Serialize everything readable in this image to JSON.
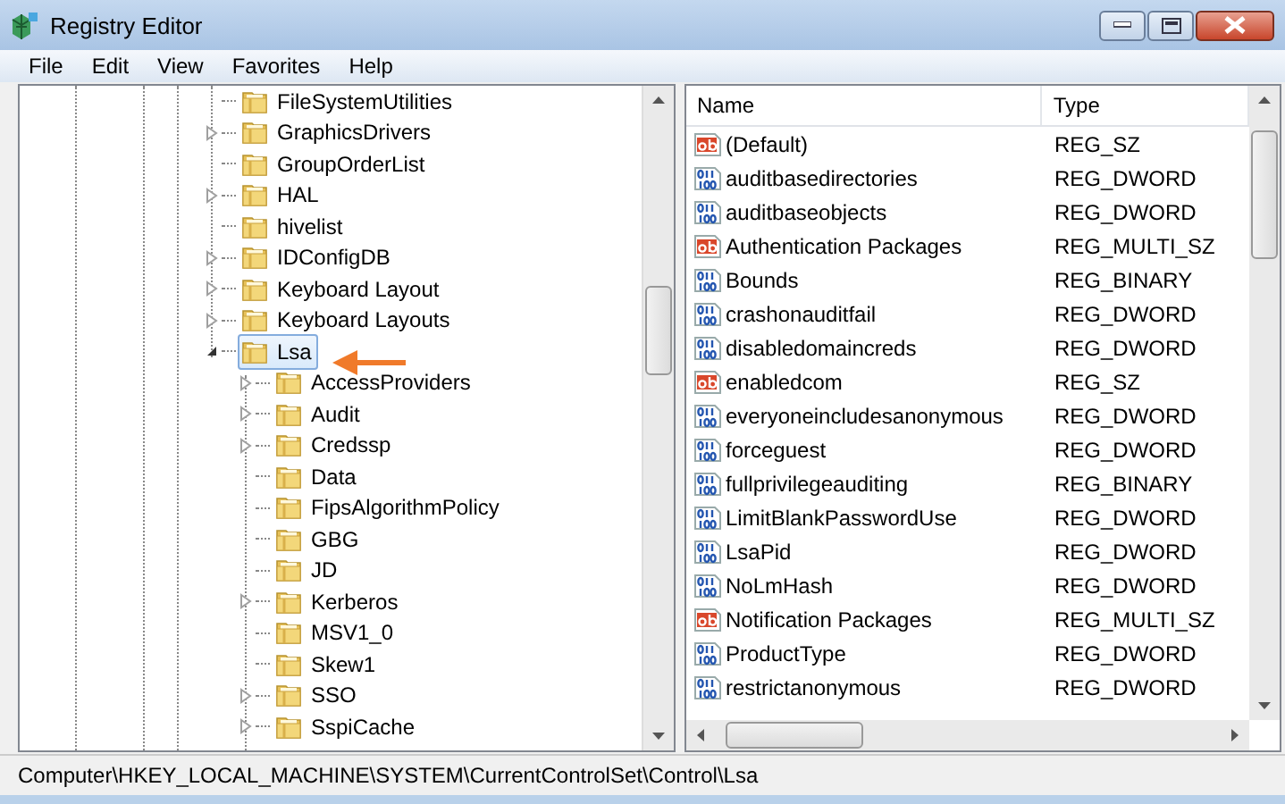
{
  "window": {
    "title": "Registry Editor"
  },
  "menu": [
    "File",
    "Edit",
    "View",
    "Favorites",
    "Help"
  ],
  "tree": [
    {
      "label": "FileSystemUtilities",
      "has_children": false,
      "expanded": false,
      "selected": false
    },
    {
      "label": "GraphicsDrivers",
      "has_children": true,
      "expanded": false,
      "selected": false
    },
    {
      "label": "GroupOrderList",
      "has_children": false,
      "expanded": false,
      "selected": false
    },
    {
      "label": "HAL",
      "has_children": true,
      "expanded": false,
      "selected": false
    },
    {
      "label": "hivelist",
      "has_children": false,
      "expanded": false,
      "selected": false
    },
    {
      "label": "IDConfigDB",
      "has_children": true,
      "expanded": false,
      "selected": false
    },
    {
      "label": "Keyboard Layout",
      "has_children": true,
      "expanded": false,
      "selected": false
    },
    {
      "label": "Keyboard Layouts",
      "has_children": true,
      "expanded": false,
      "selected": false
    },
    {
      "label": "Lsa",
      "has_children": true,
      "expanded": true,
      "selected": true,
      "children": [
        {
          "label": "AccessProviders",
          "has_children": true,
          "expanded": false,
          "selected": false
        },
        {
          "label": "Audit",
          "has_children": true,
          "expanded": false,
          "selected": false
        },
        {
          "label": "Credssp",
          "has_children": true,
          "expanded": false,
          "selected": false
        },
        {
          "label": "Data",
          "has_children": false,
          "expanded": false,
          "selected": false
        },
        {
          "label": "FipsAlgorithmPolicy",
          "has_children": false,
          "expanded": false,
          "selected": false
        },
        {
          "label": "GBG",
          "has_children": false,
          "expanded": false,
          "selected": false
        },
        {
          "label": "JD",
          "has_children": false,
          "expanded": false,
          "selected": false
        },
        {
          "label": "Kerberos",
          "has_children": true,
          "expanded": false,
          "selected": false
        },
        {
          "label": "MSV1_0",
          "has_children": false,
          "expanded": false,
          "selected": false
        },
        {
          "label": "Skew1",
          "has_children": false,
          "expanded": false,
          "selected": false
        },
        {
          "label": "SSO",
          "has_children": true,
          "expanded": false,
          "selected": false
        },
        {
          "label": "SspiCache",
          "has_children": true,
          "expanded": false,
          "selected": false
        }
      ]
    }
  ],
  "values": {
    "columns": [
      "Name",
      "Type"
    ],
    "rows": [
      {
        "name": "(Default)",
        "type": "REG_SZ",
        "kind": "string"
      },
      {
        "name": "auditbasedirectories",
        "type": "REG_DWORD",
        "kind": "binary"
      },
      {
        "name": "auditbaseobjects",
        "type": "REG_DWORD",
        "kind": "binary"
      },
      {
        "name": "Authentication Packages",
        "type": "REG_MULTI_SZ",
        "kind": "string"
      },
      {
        "name": "Bounds",
        "type": "REG_BINARY",
        "kind": "binary"
      },
      {
        "name": "crashonauditfail",
        "type": "REG_DWORD",
        "kind": "binary"
      },
      {
        "name": "disabledomaincreds",
        "type": "REG_DWORD",
        "kind": "binary"
      },
      {
        "name": "enabledcom",
        "type": "REG_SZ",
        "kind": "string"
      },
      {
        "name": "everyoneincludesanonymous",
        "type": "REG_DWORD",
        "kind": "binary"
      },
      {
        "name": "forceguest",
        "type": "REG_DWORD",
        "kind": "binary"
      },
      {
        "name": "fullprivilegeauditing",
        "type": "REG_BINARY",
        "kind": "binary"
      },
      {
        "name": "LimitBlankPasswordUse",
        "type": "REG_DWORD",
        "kind": "binary"
      },
      {
        "name": "LsaPid",
        "type": "REG_DWORD",
        "kind": "binary"
      },
      {
        "name": "NoLmHash",
        "type": "REG_DWORD",
        "kind": "binary"
      },
      {
        "name": "Notification Packages",
        "type": "REG_MULTI_SZ",
        "kind": "string"
      },
      {
        "name": "ProductType",
        "type": "REG_DWORD",
        "kind": "binary"
      },
      {
        "name": "restrictanonymous",
        "type": "REG_DWORD",
        "kind": "binary"
      }
    ]
  },
  "status_bar": "Computer\\HKEY_LOCAL_MACHINE\\SYSTEM\\CurrentControlSet\\Control\\Lsa"
}
